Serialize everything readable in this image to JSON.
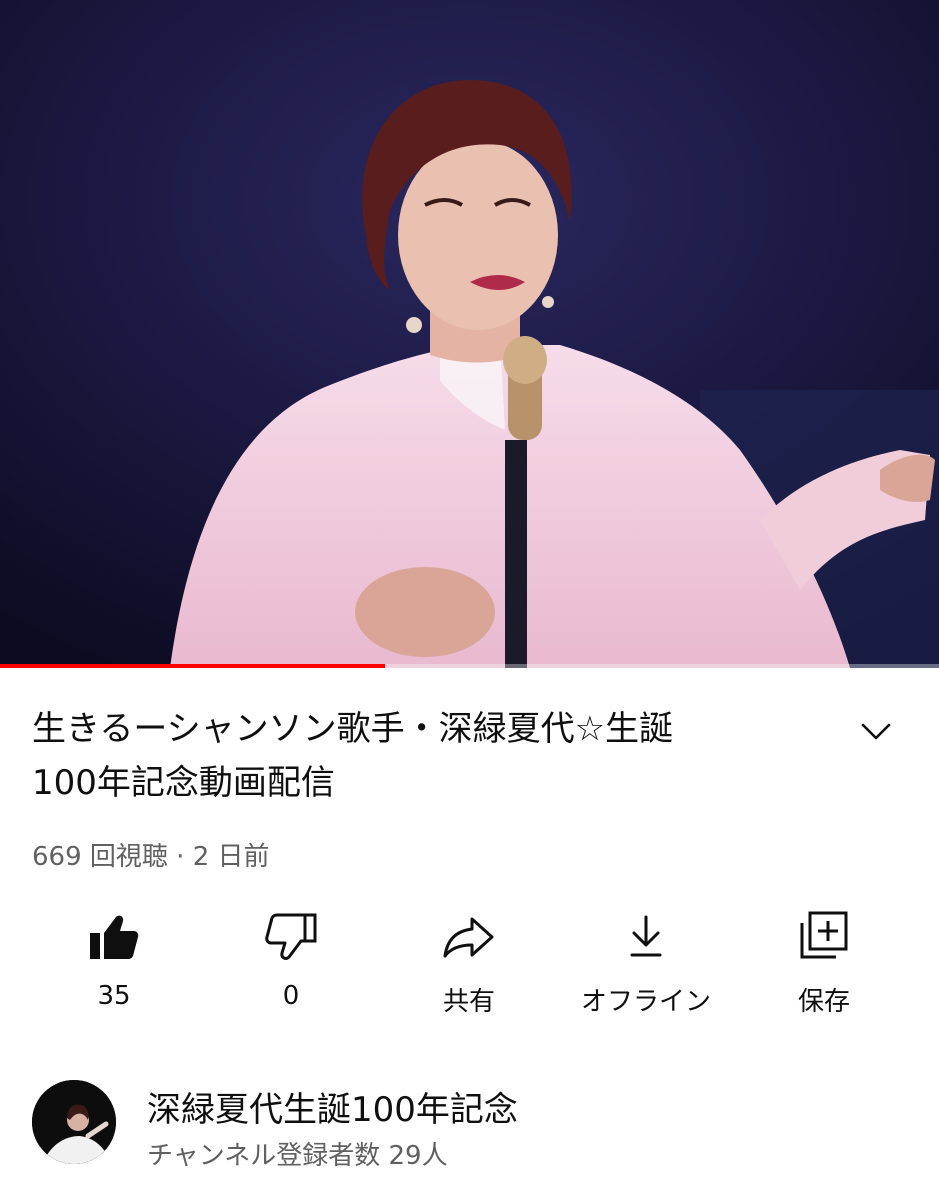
{
  "video": {
    "title": "生きるーシャンソン歌手・深緑夏代☆生誕100年記念動画配信",
    "title_line1": "生きるーシャンソン歌手・深緑夏代☆生誕",
    "title_line2": "100年記念動画配信",
    "views": "669 回視聴",
    "separator": "·",
    "age": "2 日前",
    "progress_fraction": 0.41
  },
  "actions": {
    "like": {
      "icon": "thumbs-up-filled-icon",
      "label": "35"
    },
    "dislike": {
      "icon": "thumbs-down-icon",
      "label": "0"
    },
    "share": {
      "icon": "share-arrow-icon",
      "label": "共有"
    },
    "download": {
      "icon": "download-icon",
      "label": "オフライン"
    },
    "save": {
      "icon": "add-to-playlist-icon",
      "label": "保存"
    }
  },
  "channel": {
    "name": "深緑夏代生誕100年記念",
    "subscribers": "チャンネル登録者数 29人"
  },
  "colors": {
    "progress": "#ff0000",
    "text_primary": "#0f0f0f",
    "text_secondary": "#606060",
    "stage_background": "#141232"
  }
}
